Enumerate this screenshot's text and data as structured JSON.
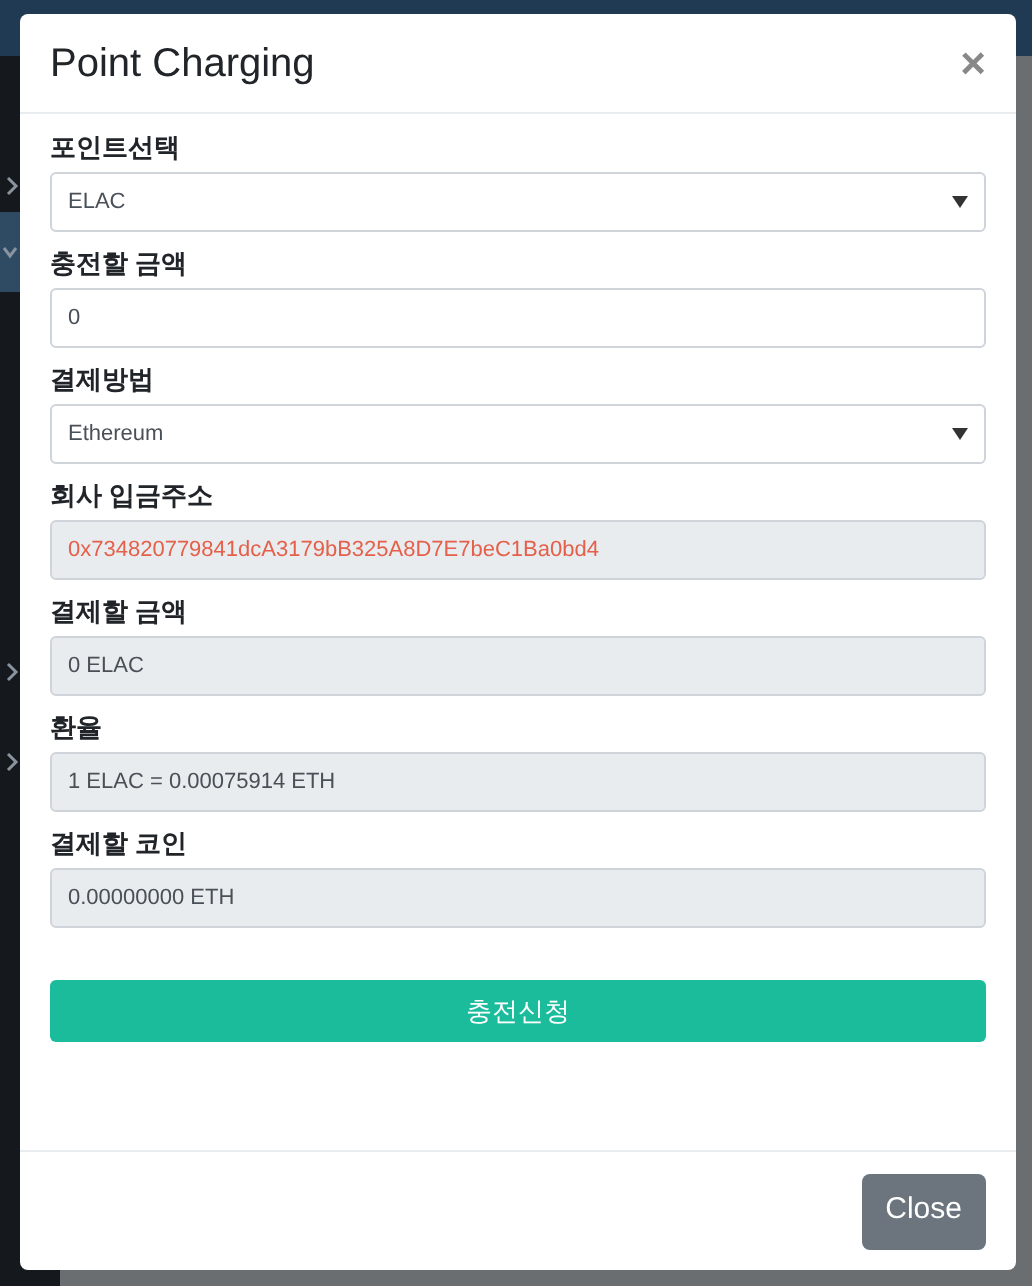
{
  "modal": {
    "title": "Point Charging",
    "close_icon": "×"
  },
  "fields": [
    {
      "label": "포인트선택",
      "kind": "select",
      "value": "ELAC"
    },
    {
      "label": "충전할 금액",
      "kind": "input",
      "value": "0"
    },
    {
      "label": "결제방법",
      "kind": "select",
      "value": "Ethereum"
    },
    {
      "label": "회사 입금주소",
      "kind": "readonly",
      "value": "0x734820779841dcA3179bB325A8D7E7beC1Ba0bd4",
      "color": "#e4604a"
    },
    {
      "label": "결제할 금액",
      "kind": "readonly",
      "value": "0 ELAC"
    },
    {
      "label": "환율",
      "kind": "readonly",
      "value": "1 ELAC = 0.00075914 ETH"
    },
    {
      "label": "결제할 코인",
      "kind": "readonly",
      "value": "0.00000000 ETH"
    }
  ],
  "submit_button": "충전신청",
  "footer": {
    "close_button": "Close"
  }
}
